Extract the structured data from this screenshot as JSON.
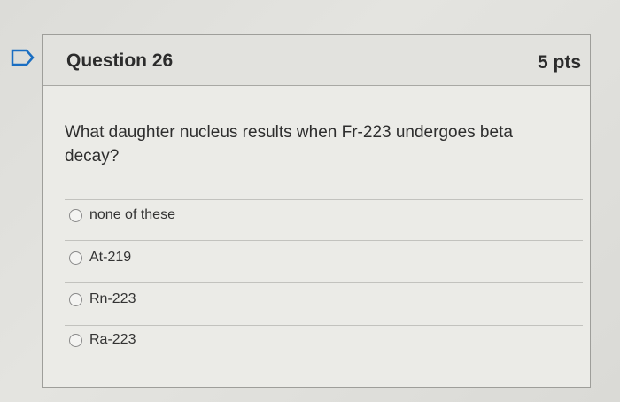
{
  "question": {
    "title": "Question 26",
    "points": "5 pts",
    "text": "What daughter nucleus results when Fr-223 undergoes beta decay?"
  },
  "answers": [
    {
      "label": "none of these",
      "selected": false
    },
    {
      "label": "At-219",
      "selected": false
    },
    {
      "label": "Rn-223",
      "selected": false
    },
    {
      "label": "Ra-223",
      "selected": false
    }
  ],
  "colors": {
    "bookmark_outline": "#1a6ec2",
    "card_background": "#ebebe7",
    "header_background": "#e2e2de"
  },
  "icons": {
    "bookmark": "bookmark-icon"
  }
}
